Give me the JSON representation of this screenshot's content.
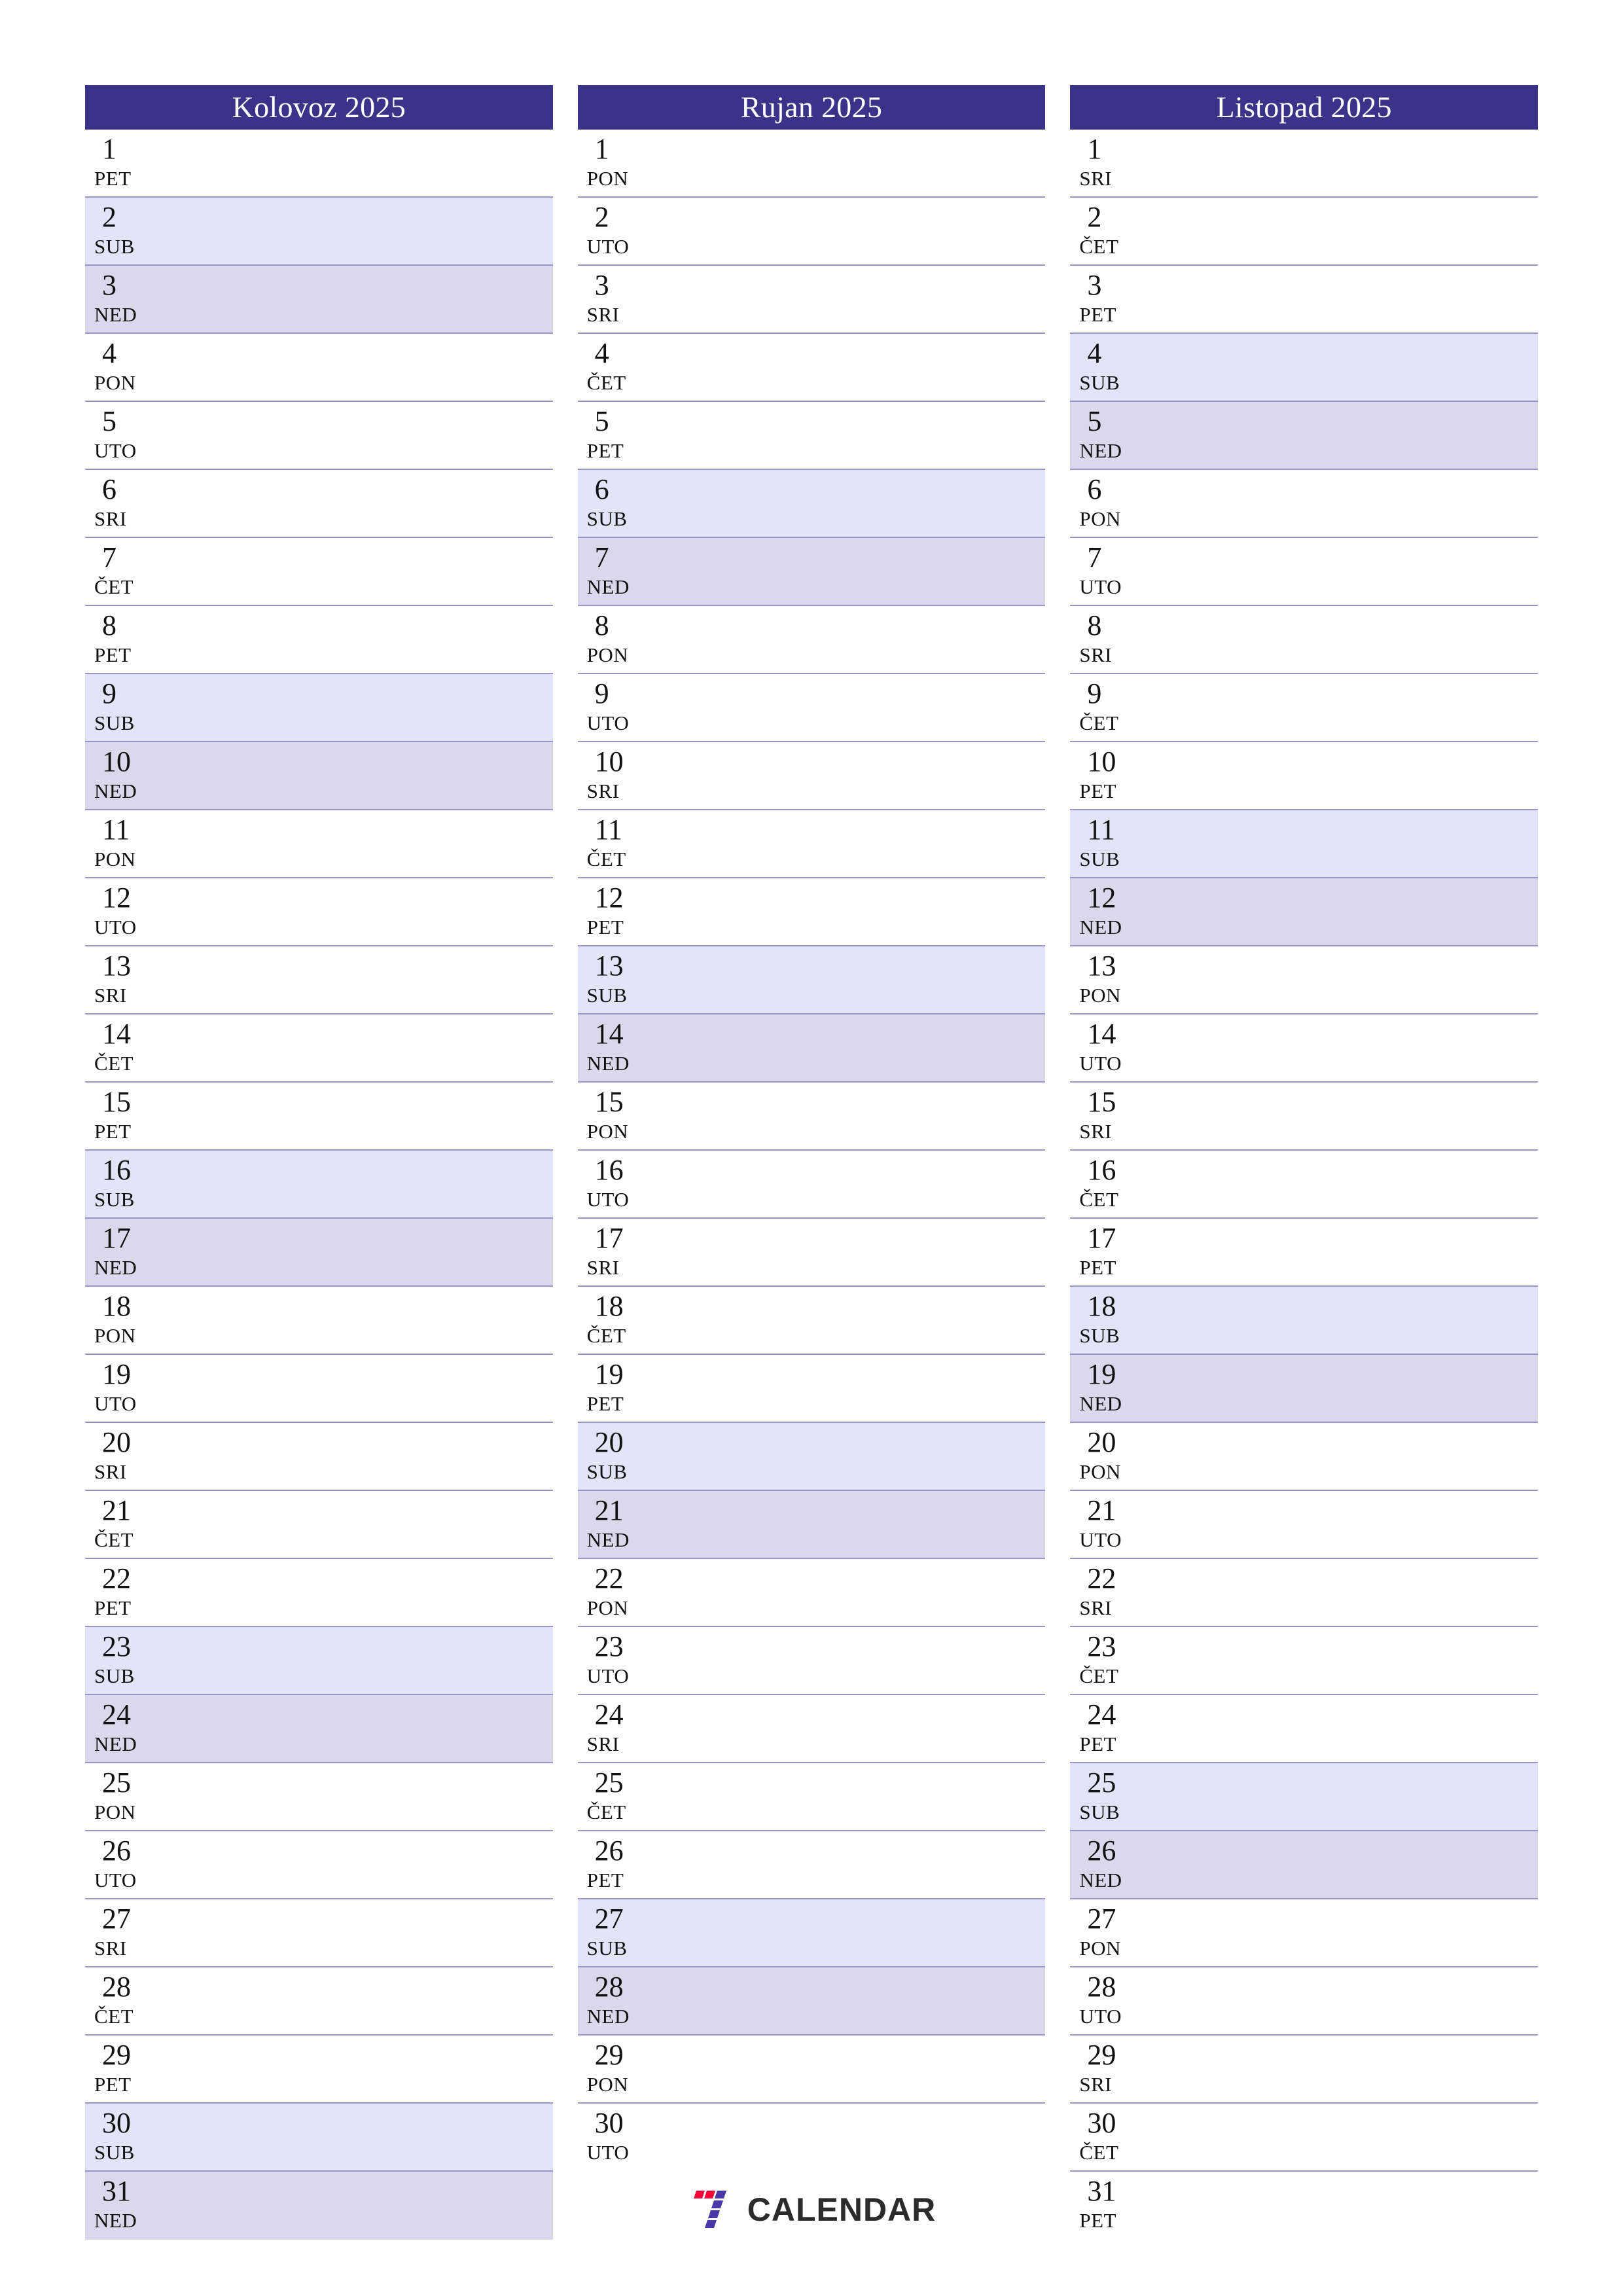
{
  "page": {
    "title": "Kolovoz - Rujan - Listopad 2025",
    "orientation": "portrait",
    "columns_count": 3
  },
  "colors": {
    "header_bg": "#3b3289",
    "header_text": "#ffffff",
    "saturday_bg": "#e3e4f7",
    "sunday_bg": "#dcd8ec",
    "row_divider": "#9a95c9",
    "day_text": "#111111",
    "logo_red": "#f50537",
    "logo_purple": "#4a37a8",
    "logo_text": "#2b2b2b"
  },
  "branding": {
    "logo_icon": "seven-logo-icon",
    "logo_text": "CALENDAR"
  },
  "months": [
    {
      "header": "Kolovoz 2025",
      "name": "Kolovoz",
      "year": "2025",
      "days": [
        {
          "num": "1",
          "abbr": "PET",
          "type": "weekday"
        },
        {
          "num": "2",
          "abbr": "SUB",
          "type": "saturday"
        },
        {
          "num": "3",
          "abbr": "NED",
          "type": "sunday"
        },
        {
          "num": "4",
          "abbr": "PON",
          "type": "weekday"
        },
        {
          "num": "5",
          "abbr": "UTO",
          "type": "weekday"
        },
        {
          "num": "6",
          "abbr": "SRI",
          "type": "weekday"
        },
        {
          "num": "7",
          "abbr": "ČET",
          "type": "weekday"
        },
        {
          "num": "8",
          "abbr": "PET",
          "type": "weekday"
        },
        {
          "num": "9",
          "abbr": "SUB",
          "type": "saturday"
        },
        {
          "num": "10",
          "abbr": "NED",
          "type": "sunday"
        },
        {
          "num": "11",
          "abbr": "PON",
          "type": "weekday"
        },
        {
          "num": "12",
          "abbr": "UTO",
          "type": "weekday"
        },
        {
          "num": "13",
          "abbr": "SRI",
          "type": "weekday"
        },
        {
          "num": "14",
          "abbr": "ČET",
          "type": "weekday"
        },
        {
          "num": "15",
          "abbr": "PET",
          "type": "weekday"
        },
        {
          "num": "16",
          "abbr": "SUB",
          "type": "saturday"
        },
        {
          "num": "17",
          "abbr": "NED",
          "type": "sunday"
        },
        {
          "num": "18",
          "abbr": "PON",
          "type": "weekday"
        },
        {
          "num": "19",
          "abbr": "UTO",
          "type": "weekday"
        },
        {
          "num": "20",
          "abbr": "SRI",
          "type": "weekday"
        },
        {
          "num": "21",
          "abbr": "ČET",
          "type": "weekday"
        },
        {
          "num": "22",
          "abbr": "PET",
          "type": "weekday"
        },
        {
          "num": "23",
          "abbr": "SUB",
          "type": "saturday"
        },
        {
          "num": "24",
          "abbr": "NED",
          "type": "sunday"
        },
        {
          "num": "25",
          "abbr": "PON",
          "type": "weekday"
        },
        {
          "num": "26",
          "abbr": "UTO",
          "type": "weekday"
        },
        {
          "num": "27",
          "abbr": "SRI",
          "type": "weekday"
        },
        {
          "num": "28",
          "abbr": "ČET",
          "type": "weekday"
        },
        {
          "num": "29",
          "abbr": "PET",
          "type": "weekday"
        },
        {
          "num": "30",
          "abbr": "SUB",
          "type": "saturday"
        },
        {
          "num": "31",
          "abbr": "NED",
          "type": "sunday"
        }
      ]
    },
    {
      "header": "Rujan 2025",
      "name": "Rujan",
      "year": "2025",
      "days": [
        {
          "num": "1",
          "abbr": "PON",
          "type": "weekday"
        },
        {
          "num": "2",
          "abbr": "UTO",
          "type": "weekday"
        },
        {
          "num": "3",
          "abbr": "SRI",
          "type": "weekday"
        },
        {
          "num": "4",
          "abbr": "ČET",
          "type": "weekday"
        },
        {
          "num": "5",
          "abbr": "PET",
          "type": "weekday"
        },
        {
          "num": "6",
          "abbr": "SUB",
          "type": "saturday"
        },
        {
          "num": "7",
          "abbr": "NED",
          "type": "sunday"
        },
        {
          "num": "8",
          "abbr": "PON",
          "type": "weekday"
        },
        {
          "num": "9",
          "abbr": "UTO",
          "type": "weekday"
        },
        {
          "num": "10",
          "abbr": "SRI",
          "type": "weekday"
        },
        {
          "num": "11",
          "abbr": "ČET",
          "type": "weekday"
        },
        {
          "num": "12",
          "abbr": "PET",
          "type": "weekday"
        },
        {
          "num": "13",
          "abbr": "SUB",
          "type": "saturday"
        },
        {
          "num": "14",
          "abbr": "NED",
          "type": "sunday"
        },
        {
          "num": "15",
          "abbr": "PON",
          "type": "weekday"
        },
        {
          "num": "16",
          "abbr": "UTO",
          "type": "weekday"
        },
        {
          "num": "17",
          "abbr": "SRI",
          "type": "weekday"
        },
        {
          "num": "18",
          "abbr": "ČET",
          "type": "weekday"
        },
        {
          "num": "19",
          "abbr": "PET",
          "type": "weekday"
        },
        {
          "num": "20",
          "abbr": "SUB",
          "type": "saturday"
        },
        {
          "num": "21",
          "abbr": "NED",
          "type": "sunday"
        },
        {
          "num": "22",
          "abbr": "PON",
          "type": "weekday"
        },
        {
          "num": "23",
          "abbr": "UTO",
          "type": "weekday"
        },
        {
          "num": "24",
          "abbr": "SRI",
          "type": "weekday"
        },
        {
          "num": "25",
          "abbr": "ČET",
          "type": "weekday"
        },
        {
          "num": "26",
          "abbr": "PET",
          "type": "weekday"
        },
        {
          "num": "27",
          "abbr": "SUB",
          "type": "saturday"
        },
        {
          "num": "28",
          "abbr": "NED",
          "type": "sunday"
        },
        {
          "num": "29",
          "abbr": "PON",
          "type": "weekday"
        },
        {
          "num": "30",
          "abbr": "UTO",
          "type": "weekday"
        }
      ]
    },
    {
      "header": "Listopad 2025",
      "name": "Listopad",
      "year": "2025",
      "days": [
        {
          "num": "1",
          "abbr": "SRI",
          "type": "weekday"
        },
        {
          "num": "2",
          "abbr": "ČET",
          "type": "weekday"
        },
        {
          "num": "3",
          "abbr": "PET",
          "type": "weekday"
        },
        {
          "num": "4",
          "abbr": "SUB",
          "type": "saturday"
        },
        {
          "num": "5",
          "abbr": "NED",
          "type": "sunday"
        },
        {
          "num": "6",
          "abbr": "PON",
          "type": "weekday"
        },
        {
          "num": "7",
          "abbr": "UTO",
          "type": "weekday"
        },
        {
          "num": "8",
          "abbr": "SRI",
          "type": "weekday"
        },
        {
          "num": "9",
          "abbr": "ČET",
          "type": "weekday"
        },
        {
          "num": "10",
          "abbr": "PET",
          "type": "weekday"
        },
        {
          "num": "11",
          "abbr": "SUB",
          "type": "saturday"
        },
        {
          "num": "12",
          "abbr": "NED",
          "type": "sunday"
        },
        {
          "num": "13",
          "abbr": "PON",
          "type": "weekday"
        },
        {
          "num": "14",
          "abbr": "UTO",
          "type": "weekday"
        },
        {
          "num": "15",
          "abbr": "SRI",
          "type": "weekday"
        },
        {
          "num": "16",
          "abbr": "ČET",
          "type": "weekday"
        },
        {
          "num": "17",
          "abbr": "PET",
          "type": "weekday"
        },
        {
          "num": "18",
          "abbr": "SUB",
          "type": "saturday"
        },
        {
          "num": "19",
          "abbr": "NED",
          "type": "sunday"
        },
        {
          "num": "20",
          "abbr": "PON",
          "type": "weekday"
        },
        {
          "num": "21",
          "abbr": "UTO",
          "type": "weekday"
        },
        {
          "num": "22",
          "abbr": "SRI",
          "type": "weekday"
        },
        {
          "num": "23",
          "abbr": "ČET",
          "type": "weekday"
        },
        {
          "num": "24",
          "abbr": "PET",
          "type": "weekday"
        },
        {
          "num": "25",
          "abbr": "SUB",
          "type": "saturday"
        },
        {
          "num": "26",
          "abbr": "NED",
          "type": "sunday"
        },
        {
          "num": "27",
          "abbr": "PON",
          "type": "weekday"
        },
        {
          "num": "28",
          "abbr": "UTO",
          "type": "weekday"
        },
        {
          "num": "29",
          "abbr": "SRI",
          "type": "weekday"
        },
        {
          "num": "30",
          "abbr": "ČET",
          "type": "weekday"
        },
        {
          "num": "31",
          "abbr": "PET",
          "type": "weekday"
        }
      ]
    }
  ]
}
